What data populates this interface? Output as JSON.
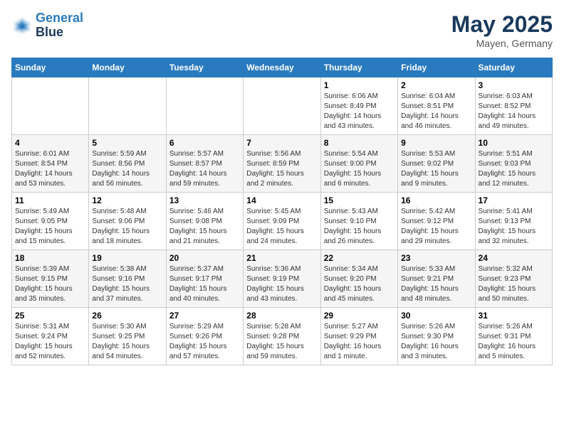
{
  "header": {
    "logo_line1": "General",
    "logo_line2": "Blue",
    "month_year": "May 2025",
    "location": "Mayen, Germany"
  },
  "days_of_week": [
    "Sunday",
    "Monday",
    "Tuesday",
    "Wednesday",
    "Thursday",
    "Friday",
    "Saturday"
  ],
  "weeks": [
    [
      {
        "num": "",
        "info": ""
      },
      {
        "num": "",
        "info": ""
      },
      {
        "num": "",
        "info": ""
      },
      {
        "num": "",
        "info": ""
      },
      {
        "num": "1",
        "info": "Sunrise: 6:06 AM\nSunset: 8:49 PM\nDaylight: 14 hours and 43 minutes."
      },
      {
        "num": "2",
        "info": "Sunrise: 6:04 AM\nSunset: 8:51 PM\nDaylight: 14 hours and 46 minutes."
      },
      {
        "num": "3",
        "info": "Sunrise: 6:03 AM\nSunset: 8:52 PM\nDaylight: 14 hours and 49 minutes."
      }
    ],
    [
      {
        "num": "4",
        "info": "Sunrise: 6:01 AM\nSunset: 8:54 PM\nDaylight: 14 hours and 53 minutes."
      },
      {
        "num": "5",
        "info": "Sunrise: 5:59 AM\nSunset: 8:56 PM\nDaylight: 14 hours and 56 minutes."
      },
      {
        "num": "6",
        "info": "Sunrise: 5:57 AM\nSunset: 8:57 PM\nDaylight: 14 hours and 59 minutes."
      },
      {
        "num": "7",
        "info": "Sunrise: 5:56 AM\nSunset: 8:59 PM\nDaylight: 15 hours and 2 minutes."
      },
      {
        "num": "8",
        "info": "Sunrise: 5:54 AM\nSunset: 9:00 PM\nDaylight: 15 hours and 6 minutes."
      },
      {
        "num": "9",
        "info": "Sunrise: 5:53 AM\nSunset: 9:02 PM\nDaylight: 15 hours and 9 minutes."
      },
      {
        "num": "10",
        "info": "Sunrise: 5:51 AM\nSunset: 9:03 PM\nDaylight: 15 hours and 12 minutes."
      }
    ],
    [
      {
        "num": "11",
        "info": "Sunrise: 5:49 AM\nSunset: 9:05 PM\nDaylight: 15 hours and 15 minutes."
      },
      {
        "num": "12",
        "info": "Sunrise: 5:48 AM\nSunset: 9:06 PM\nDaylight: 15 hours and 18 minutes."
      },
      {
        "num": "13",
        "info": "Sunrise: 5:46 AM\nSunset: 9:08 PM\nDaylight: 15 hours and 21 minutes."
      },
      {
        "num": "14",
        "info": "Sunrise: 5:45 AM\nSunset: 9:09 PM\nDaylight: 15 hours and 24 minutes."
      },
      {
        "num": "15",
        "info": "Sunrise: 5:43 AM\nSunset: 9:10 PM\nDaylight: 15 hours and 26 minutes."
      },
      {
        "num": "16",
        "info": "Sunrise: 5:42 AM\nSunset: 9:12 PM\nDaylight: 15 hours and 29 minutes."
      },
      {
        "num": "17",
        "info": "Sunrise: 5:41 AM\nSunset: 9:13 PM\nDaylight: 15 hours and 32 minutes."
      }
    ],
    [
      {
        "num": "18",
        "info": "Sunrise: 5:39 AM\nSunset: 9:15 PM\nDaylight: 15 hours and 35 minutes."
      },
      {
        "num": "19",
        "info": "Sunrise: 5:38 AM\nSunset: 9:16 PM\nDaylight: 15 hours and 37 minutes."
      },
      {
        "num": "20",
        "info": "Sunrise: 5:37 AM\nSunset: 9:17 PM\nDaylight: 15 hours and 40 minutes."
      },
      {
        "num": "21",
        "info": "Sunrise: 5:36 AM\nSunset: 9:19 PM\nDaylight: 15 hours and 43 minutes."
      },
      {
        "num": "22",
        "info": "Sunrise: 5:34 AM\nSunset: 9:20 PM\nDaylight: 15 hours and 45 minutes."
      },
      {
        "num": "23",
        "info": "Sunrise: 5:33 AM\nSunset: 9:21 PM\nDaylight: 15 hours and 48 minutes."
      },
      {
        "num": "24",
        "info": "Sunrise: 5:32 AM\nSunset: 9:23 PM\nDaylight: 15 hours and 50 minutes."
      }
    ],
    [
      {
        "num": "25",
        "info": "Sunrise: 5:31 AM\nSunset: 9:24 PM\nDaylight: 15 hours and 52 minutes."
      },
      {
        "num": "26",
        "info": "Sunrise: 5:30 AM\nSunset: 9:25 PM\nDaylight: 15 hours and 54 minutes."
      },
      {
        "num": "27",
        "info": "Sunrise: 5:29 AM\nSunset: 9:26 PM\nDaylight: 15 hours and 57 minutes."
      },
      {
        "num": "28",
        "info": "Sunrise: 5:28 AM\nSunset: 9:28 PM\nDaylight: 15 hours and 59 minutes."
      },
      {
        "num": "29",
        "info": "Sunrise: 5:27 AM\nSunset: 9:29 PM\nDaylight: 16 hours and 1 minute."
      },
      {
        "num": "30",
        "info": "Sunrise: 5:26 AM\nSunset: 9:30 PM\nDaylight: 16 hours and 3 minutes."
      },
      {
        "num": "31",
        "info": "Sunrise: 5:26 AM\nSunset: 9:31 PM\nDaylight: 16 hours and 5 minutes."
      }
    ]
  ]
}
